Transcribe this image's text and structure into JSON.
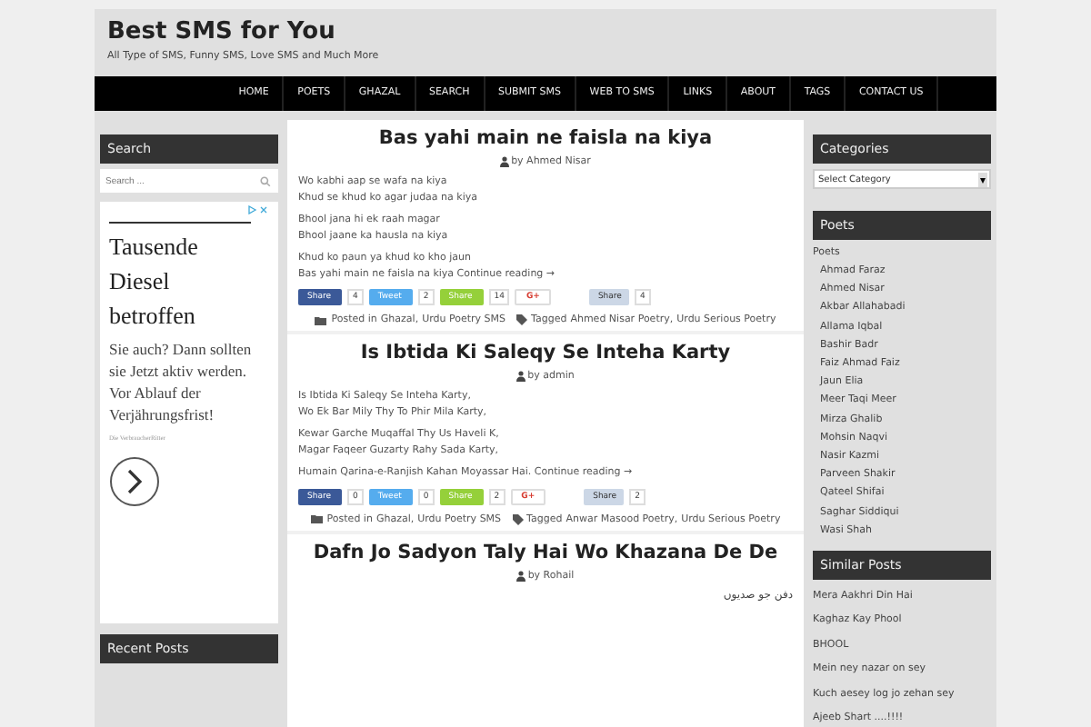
{
  "site": {
    "title": "Best SMS for You",
    "tagline": "All Type of SMS, Funny SMS, Love SMS and Much More"
  },
  "nav": [
    "HOME",
    "POETS",
    "GHAZAL",
    "SEARCH",
    "SUBMIT SMS",
    "WEB TO SMS",
    "LINKS",
    "ABOUT",
    "TAGS",
    "CONTACT US"
  ],
  "left": {
    "search": {
      "title": "Search",
      "placeholder": "Search ..."
    },
    "ad": {
      "headline": "Tausende Diesel betroffen",
      "body": "Sie auch? Dann sollten sie Jetzt aktiv werden. Vor Ablauf der Verjährungsfrist!",
      "advertiser": "Die VerbraucherRitter"
    },
    "recent_title": "Recent Posts"
  },
  "posts": [
    {
      "title": "Bas yahi main ne faisla na kiya",
      "author": "by Ahmed Nisar",
      "stanzas": [
        [
          "Wo kabhi aap se wafa na kiya",
          "Khud se khud ko agar judaa na kiya"
        ],
        [
          "Bhool jana hi ek raah magar",
          "Bhool jaane ka hausla na kiya"
        ],
        [
          "Khud ko paun ya khud ko kho jaun",
          "Bas yahi main ne faisla na kiya"
        ]
      ],
      "more": "Continue reading →",
      "shares": [
        {
          "kind": "facebook",
          "label": "Share",
          "count": "4"
        },
        {
          "kind": "twitter",
          "label": "Tweet",
          "count": "2"
        },
        {
          "kind": "share",
          "label": "Share",
          "count": "14"
        },
        {
          "kind": "gplus",
          "label": "G+"
        },
        {
          "kind": "linkedin",
          "label": "Share",
          "count": "4"
        }
      ],
      "posted_label": "Posted in",
      "categories": [
        "Ghazal,",
        "Urdu Poetry SMS"
      ],
      "tagged_label": "Tagged",
      "tags": [
        "Ahmed Nisar Poetry,",
        "Urdu Serious Poetry"
      ]
    },
    {
      "title": "Is Ibtida Ki Saleqy Se Inteha Karty",
      "author": "by admin",
      "stanzas": [
        [
          "Is Ibtida Ki Saleqy Se Inteha Karty,",
          "Wo Ek Bar Mily Thy To Phir Mila Karty,"
        ],
        [
          "Kewar Garche Muqaffal Thy Us Haveli K,",
          "Magar Faqeer Guzarty Rahy Sada Karty,"
        ],
        [
          "Humain Qarina-e-Ranjish Kahan Moyassar Hai."
        ]
      ],
      "more": "Continue reading →",
      "shares": [
        {
          "kind": "facebook",
          "label": "Share",
          "count": "0"
        },
        {
          "kind": "twitter",
          "label": "Tweet",
          "count": "0"
        },
        {
          "kind": "share",
          "label": "Share",
          "count": "2"
        },
        {
          "kind": "gplus",
          "label": "G+"
        },
        {
          "kind": "linkedin",
          "label": "Share",
          "count": "2"
        }
      ],
      "posted_label": "Posted in",
      "categories": [
        "Ghazal,",
        "Urdu Poetry SMS"
      ],
      "tagged_label": "Tagged",
      "tags": [
        "Anwar Masood Poetry,",
        "Urdu Serious Poetry"
      ]
    },
    {
      "title": "Dafn Jo Sadyon Taly Hai Wo Khazana De De",
      "author": "by Rohail",
      "excerpt": "دفن جو صدیوں"
    }
  ],
  "right": {
    "categories": {
      "title": "Categories",
      "select": "Select Category"
    },
    "poets": {
      "title": "Poets",
      "root": "Poets",
      "items": [
        "Ahmad Faraz",
        "Ahmed Nisar",
        "Akbar Allahabadi",
        "Allama Iqbal",
        "Bashir Badr",
        "Faiz Ahmad Faiz",
        "Jaun Elia",
        "Meer Taqi Meer",
        "Mirza Ghalib",
        "Mohsin Naqvi",
        "Nasir Kazmi",
        "Parveen Shakir",
        "Qateel Shifai",
        "Saghar Siddiqui",
        "Wasi Shah"
      ]
    },
    "similar": {
      "title": "Similar Posts",
      "items": [
        "Mera Aakhri Din Hai",
        "Kaghaz Kay Phool",
        "BHOOL",
        "Mein ney nazar on sey",
        "Kuch aesey log jo zehan sey",
        "Ajeeb Shart ....!!!!"
      ]
    }
  }
}
